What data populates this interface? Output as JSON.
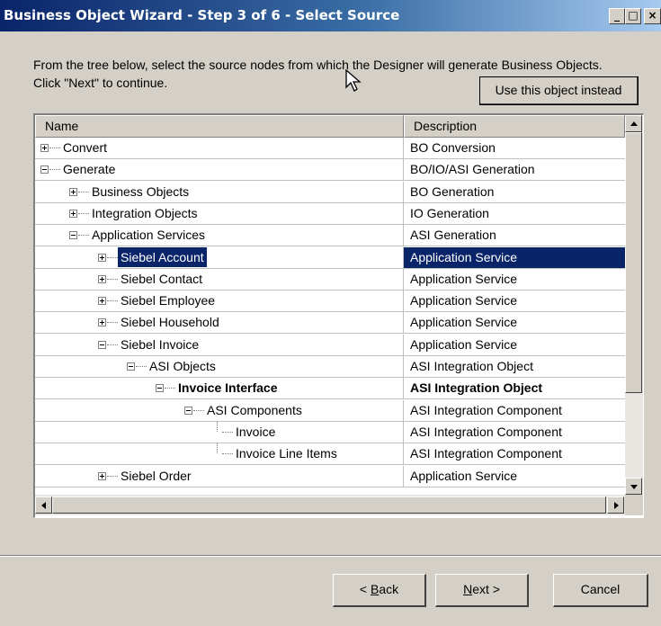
{
  "window": {
    "title": "Business Object Wizard - Step 3 of 6 - Select Source",
    "minimize": "_",
    "maximize": "□",
    "close": "×"
  },
  "instructions": "From the tree below, select the source nodes from which the Designer will generate Business Objects. Click \"Next\" to continue.",
  "use_object_button": "Use this object instead",
  "tree": {
    "columns": [
      "Name",
      "Description"
    ],
    "rows": [
      {
        "name": "Convert",
        "description": "BO Conversion",
        "level": 0,
        "expander": "plus",
        "selected": false,
        "bold": false
      },
      {
        "name": "Generate",
        "description": "BO/IO/ASI Generation",
        "level": 0,
        "expander": "minus",
        "selected": false,
        "bold": false
      },
      {
        "name": "Business Objects",
        "description": "BO Generation",
        "level": 1,
        "expander": "plus",
        "selected": false,
        "bold": false
      },
      {
        "name": "Integration Objects",
        "description": "IO Generation",
        "level": 1,
        "expander": "plus",
        "selected": false,
        "bold": false
      },
      {
        "name": "Application Services",
        "description": "ASI Generation",
        "level": 1,
        "expander": "minus",
        "selected": false,
        "bold": false
      },
      {
        "name": "Siebel Account",
        "description": "Application Service",
        "level": 2,
        "expander": "plus",
        "selected": true,
        "bold": false
      },
      {
        "name": "Siebel Contact",
        "description": "Application Service",
        "level": 2,
        "expander": "plus",
        "selected": false,
        "bold": false
      },
      {
        "name": "Siebel Employee",
        "description": "Application Service",
        "level": 2,
        "expander": "plus",
        "selected": false,
        "bold": false
      },
      {
        "name": "Siebel Household",
        "description": "Application Service",
        "level": 2,
        "expander": "plus",
        "selected": false,
        "bold": false
      },
      {
        "name": "Siebel Invoice",
        "description": "Application Service",
        "level": 2,
        "expander": "minus",
        "selected": false,
        "bold": false
      },
      {
        "name": "ASI Objects",
        "description": "ASI Integration Object",
        "level": 3,
        "expander": "minus",
        "selected": false,
        "bold": false
      },
      {
        "name": "Invoice Interface",
        "description": "ASI Integration Object",
        "level": 4,
        "expander": "minus",
        "selected": false,
        "bold": true
      },
      {
        "name": "ASI Components",
        "description": "ASI Integration Component",
        "level": 5,
        "expander": "minus",
        "selected": false,
        "bold": false
      },
      {
        "name": "Invoice",
        "description": "ASI Integration Component",
        "level": 6,
        "expander": "none",
        "selected": false,
        "bold": false
      },
      {
        "name": "Invoice Line Items",
        "description": "ASI Integration Component",
        "level": 6,
        "expander": "none",
        "selected": false,
        "bold": false
      },
      {
        "name": "Siebel Order",
        "description": "Application Service",
        "level": 2,
        "expander": "plus",
        "selected": false,
        "bold": false
      }
    ]
  },
  "buttons": {
    "back": {
      "prefix": "< ",
      "accel": "B",
      "rest": "ack"
    },
    "next": {
      "accel": "N",
      "rest": "ext >"
    },
    "cancel": "Cancel"
  },
  "icons": [
    "minimize-icon",
    "maximize-icon",
    "close-icon",
    "mouse-pointer-icon",
    "expand-icon",
    "collapse-icon",
    "scroll-up-icon",
    "scroll-down-icon",
    "scroll-left-icon",
    "scroll-right-icon"
  ]
}
